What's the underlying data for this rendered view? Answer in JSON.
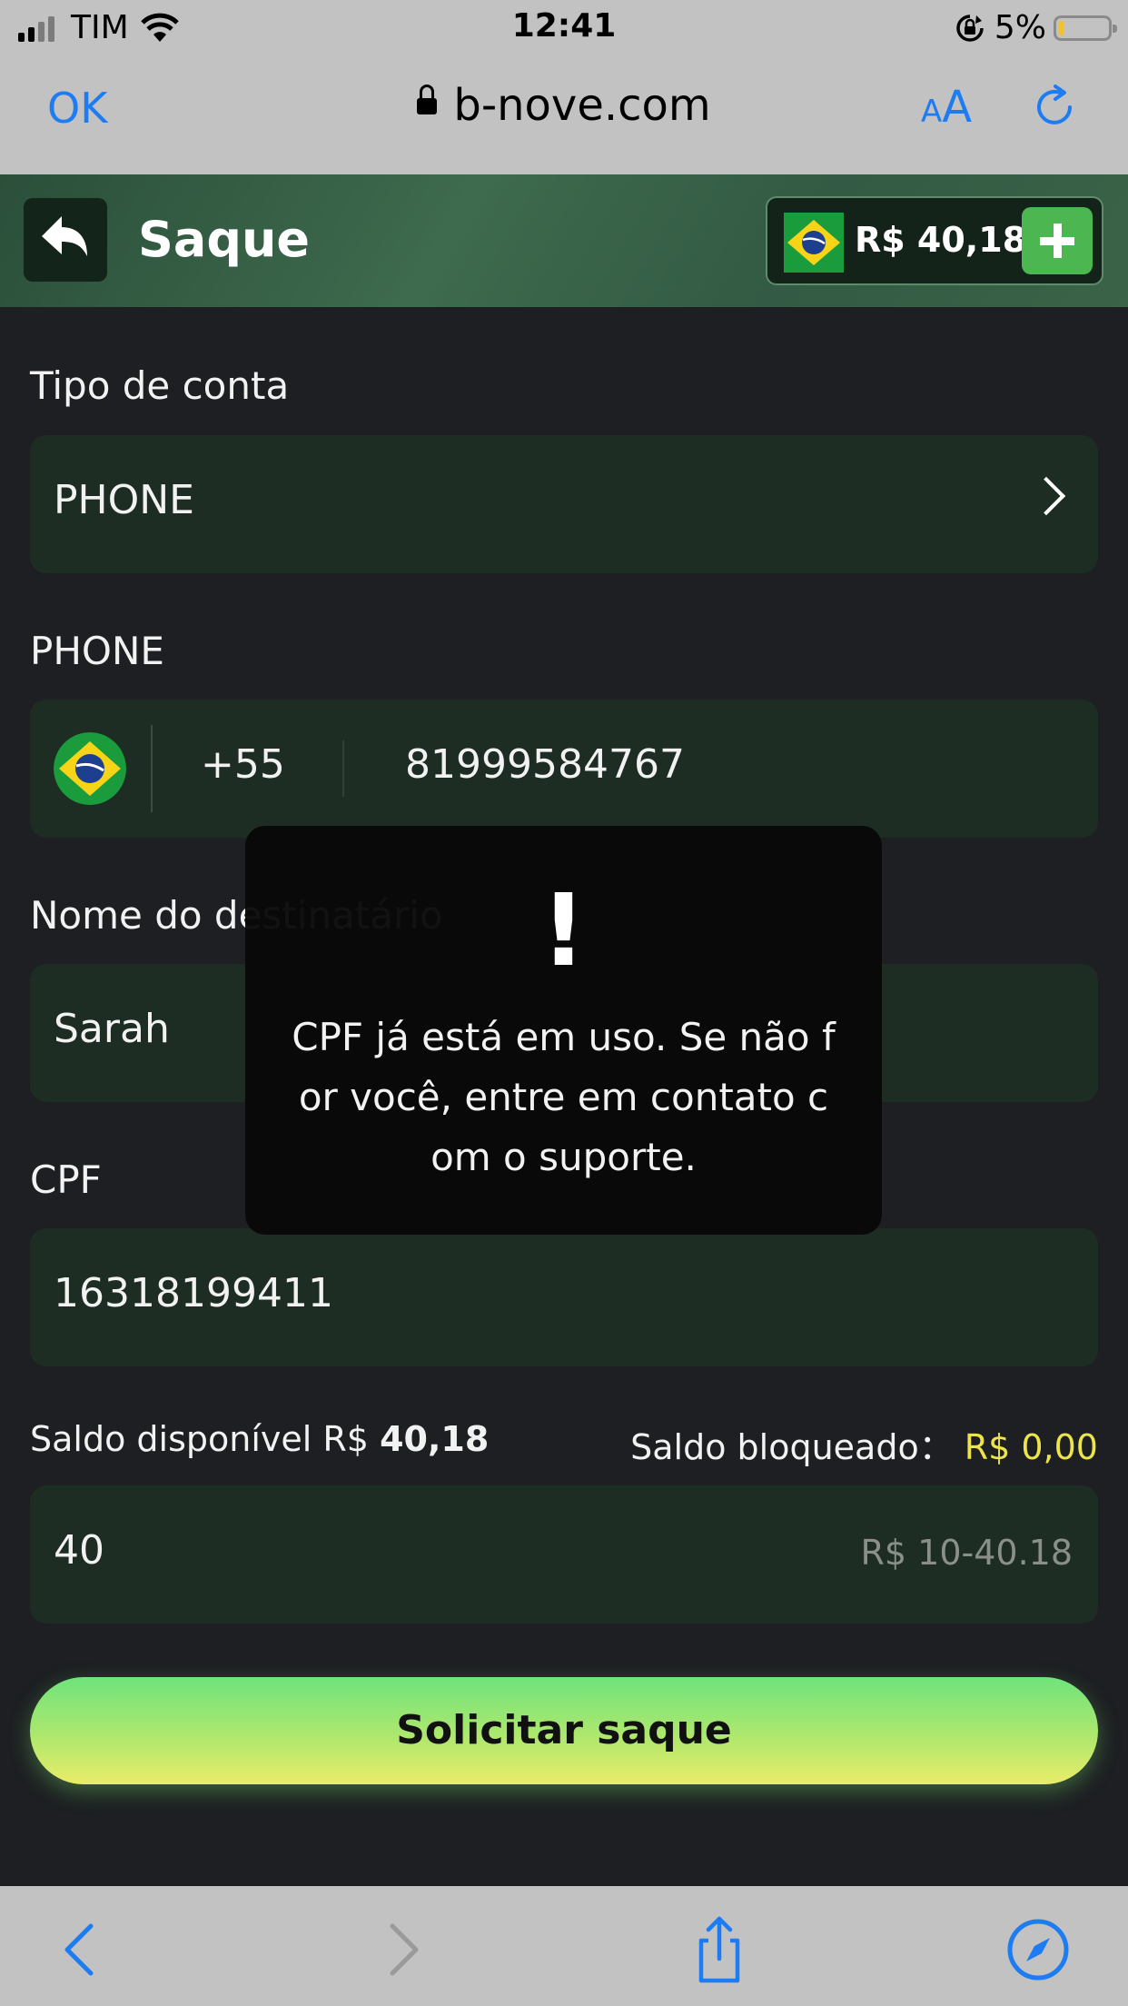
{
  "status_bar": {
    "carrier": "TIM",
    "time": "12:41",
    "battery": "5%"
  },
  "browser": {
    "done_label": "OK",
    "url": "b-nove.com",
    "text_size_small": "A",
    "text_size_big": "A"
  },
  "header": {
    "title": "Saque",
    "balance": "R$ 40,18"
  },
  "form": {
    "account_type_label": "Tipo de conta",
    "account_type_value": "PHONE",
    "phone_label": "PHONE",
    "country_code": "+55",
    "phone_value": "81999584767",
    "recipient_label": "Nome do destinatário",
    "recipient_value": "Sarah",
    "cpf_label": "CPF",
    "cpf_value": "16318199411",
    "available_label": "Saldo disponível R$",
    "available_value": "40,18",
    "blocked_label": "Saldo bloqueado：",
    "blocked_value": "R$ 0,00",
    "amount_value": "40",
    "amount_range": "R$ 10-40.18",
    "submit_label": "Solicitar saque"
  },
  "toast": {
    "icon_text": "!",
    "message": "CPF já está em uso. Se não for você, entre em contato com o suporte."
  },
  "colors": {
    "accent_green": "#4cb650",
    "balance_yellow": "#ece44a",
    "field_bg": "#1e2d23",
    "ios_blue": "#1d7cf2"
  }
}
